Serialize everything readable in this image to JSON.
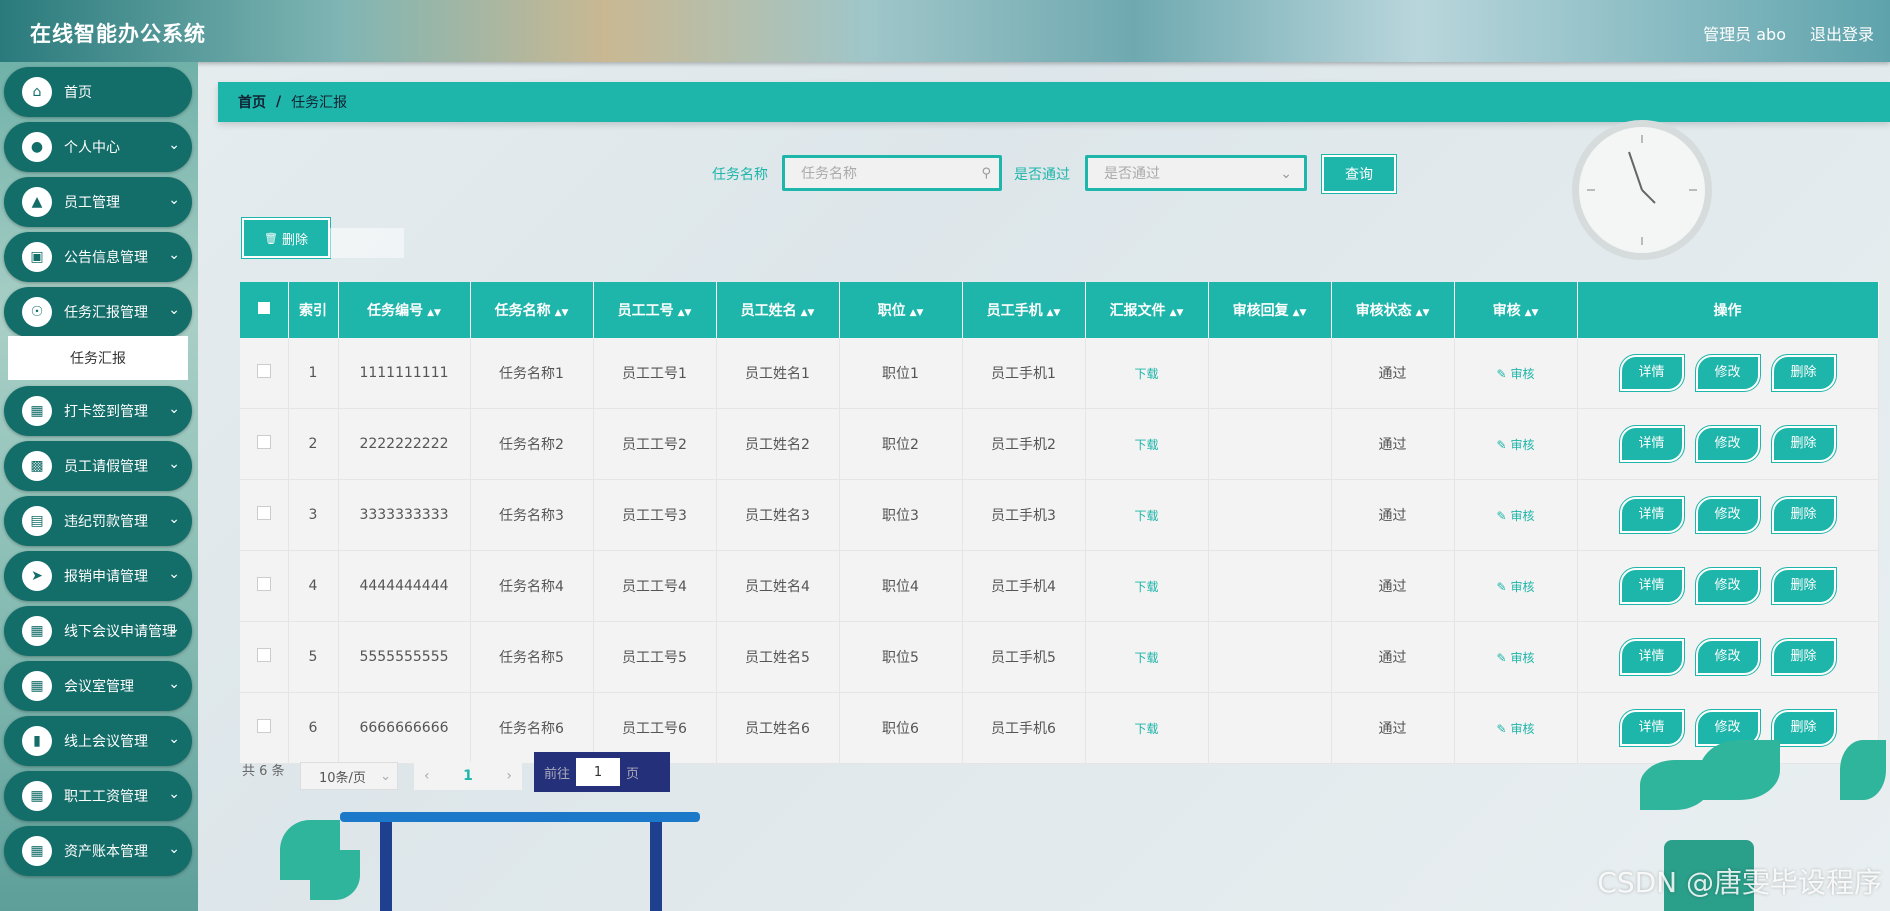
{
  "app": {
    "title": "在线智能办公系统",
    "user": "管理员 abo",
    "logout": "退出登录"
  },
  "sidebar": {
    "items": [
      {
        "label": "首页",
        "icon": "home-icon"
      },
      {
        "label": "个人中心",
        "icon": "user-icon"
      },
      {
        "label": "员工管理",
        "icon": "staff-icon"
      },
      {
        "label": "公告信息管理",
        "icon": "monitor-icon"
      },
      {
        "label": "任务汇报管理",
        "icon": "bulb-icon"
      },
      {
        "label": "打卡签到管理",
        "icon": "grid-icon"
      },
      {
        "label": "员工请假管理",
        "icon": "desktop-icon"
      },
      {
        "label": "违纪罚款管理",
        "icon": "chart-icon"
      },
      {
        "label": "报销申请管理",
        "icon": "send-icon"
      },
      {
        "label": "线下会议申请管理",
        "icon": "grid-icon"
      },
      {
        "label": "会议室管理",
        "icon": "grid-icon"
      },
      {
        "label": "线上会议管理",
        "icon": "bar-chart-icon"
      },
      {
        "label": "职工工资管理",
        "icon": "grid-icon"
      },
      {
        "label": "资产账本管理",
        "icon": "grid-icon"
      }
    ],
    "sub_item": "任务汇报"
  },
  "breadcrumb": {
    "home": "首页",
    "separator": "/",
    "current": "任务汇报"
  },
  "search": {
    "name_label": "任务名称",
    "name_placeholder": "任务名称",
    "pass_label": "是否通过",
    "pass_placeholder": "是否通过",
    "query_button": "查询"
  },
  "toolbar": {
    "delete_button": "删除"
  },
  "table": {
    "headers": [
      "索引",
      "任务编号",
      "任务名称",
      "员工工号",
      "员工姓名",
      "职位",
      "员工手机",
      "汇报文件",
      "审核回复",
      "审核状态",
      "审核",
      "操作"
    ],
    "rows": [
      {
        "index": "1",
        "code": "1111111111",
        "name": "任务名称1",
        "emp_no": "员工工号1",
        "emp_name": "员工姓名1",
        "position": "职位1",
        "phone": "员工手机1",
        "file": "下载",
        "reply": "",
        "status": "通过",
        "audit": "审核"
      },
      {
        "index": "2",
        "code": "2222222222",
        "name": "任务名称2",
        "emp_no": "员工工号2",
        "emp_name": "员工姓名2",
        "position": "职位2",
        "phone": "员工手机2",
        "file": "下载",
        "reply": "",
        "status": "通过",
        "audit": "审核"
      },
      {
        "index": "3",
        "code": "3333333333",
        "name": "任务名称3",
        "emp_no": "员工工号3",
        "emp_name": "员工姓名3",
        "position": "职位3",
        "phone": "员工手机3",
        "file": "下载",
        "reply": "",
        "status": "通过",
        "audit": "审核"
      },
      {
        "index": "4",
        "code": "4444444444",
        "name": "任务名称4",
        "emp_no": "员工工号4",
        "emp_name": "员工姓名4",
        "position": "职位4",
        "phone": "员工手机4",
        "file": "下载",
        "reply": "",
        "status": "通过",
        "audit": "审核"
      },
      {
        "index": "5",
        "code": "5555555555",
        "name": "任务名称5",
        "emp_no": "员工工号5",
        "emp_name": "员工姓名5",
        "position": "职位5",
        "phone": "员工手机5",
        "file": "下载",
        "reply": "",
        "status": "通过",
        "audit": "审核"
      },
      {
        "index": "6",
        "code": "6666666666",
        "name": "任务名称6",
        "emp_no": "员工工号6",
        "emp_name": "员工姓名6",
        "position": "职位6",
        "phone": "员工手机6",
        "file": "下载",
        "reply": "",
        "status": "通过",
        "audit": "审核"
      }
    ],
    "actions": {
      "detail": "详情",
      "edit": "修改",
      "delete": "删除"
    }
  },
  "pagination": {
    "total": "共 6 条",
    "page_size": "10条/页",
    "current_page": "1",
    "goto_prefix": "前往",
    "goto_value": "1",
    "goto_suffix": "页"
  },
  "watermark": "CSDN @唐雯毕设程序",
  "colors": {
    "accent": "#1eb5aa",
    "sidebar_item": "#136d69"
  }
}
